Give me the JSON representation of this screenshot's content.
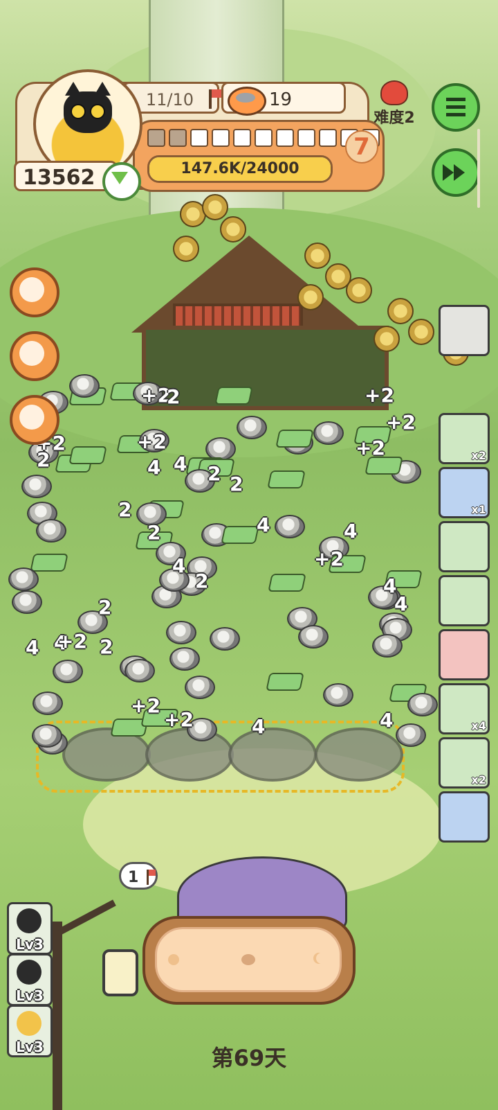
{
  "hud": {
    "coins": "13562",
    "flags": "11/10",
    "food": "19",
    "level": "7",
    "progress_text": "147.6K/24000",
    "progress_fraction": 1.0,
    "level_blocks_total": 11,
    "level_blocks_filled": 2
  },
  "difficulty": {
    "label": "难度2"
  },
  "side_cards": [
    {
      "name": "side-card-leaf",
      "badge": "x2",
      "tone": "green"
    },
    {
      "name": "side-card-gear",
      "badge": "x1",
      "tone": "blue"
    },
    {
      "name": "side-card-hut",
      "badge": "",
      "tone": "green"
    },
    {
      "name": "side-card-ticket",
      "badge": "",
      "tone": "green"
    },
    {
      "name": "side-card-skeleton",
      "badge": "",
      "tone": "red"
    },
    {
      "name": "side-card-fish",
      "badge": "x4",
      "tone": "green"
    },
    {
      "name": "side-card-sack",
      "badge": "x2",
      "tone": "green"
    },
    {
      "name": "side-card-stall",
      "badge": "",
      "tone": "blue"
    }
  ],
  "floating_numbers": [
    "2",
    "+2",
    "4",
    "+2",
    "2",
    "4",
    "+2",
    "2",
    "4",
    "+2",
    "4",
    "2",
    "+2",
    "4",
    "2",
    "4",
    "+2",
    "2",
    "4",
    "+2",
    "2",
    "4",
    "+2",
    "4",
    "2",
    "+2",
    "4",
    "2",
    "+2",
    "4"
  ],
  "bubble": {
    "count": "1"
  },
  "levels": [
    {
      "name": "lv-card-ghost",
      "label": "Lv3"
    },
    {
      "name": "lv-card-frog",
      "label": "Lv3"
    },
    {
      "name": "lv-card-skull",
      "label": "Lv3"
    }
  ],
  "day_label": "第69天",
  "colors": {
    "accent_green": "#6cd35a",
    "hud_orange": "#f3a45f",
    "progress_yellow": "#f8cf4c"
  }
}
